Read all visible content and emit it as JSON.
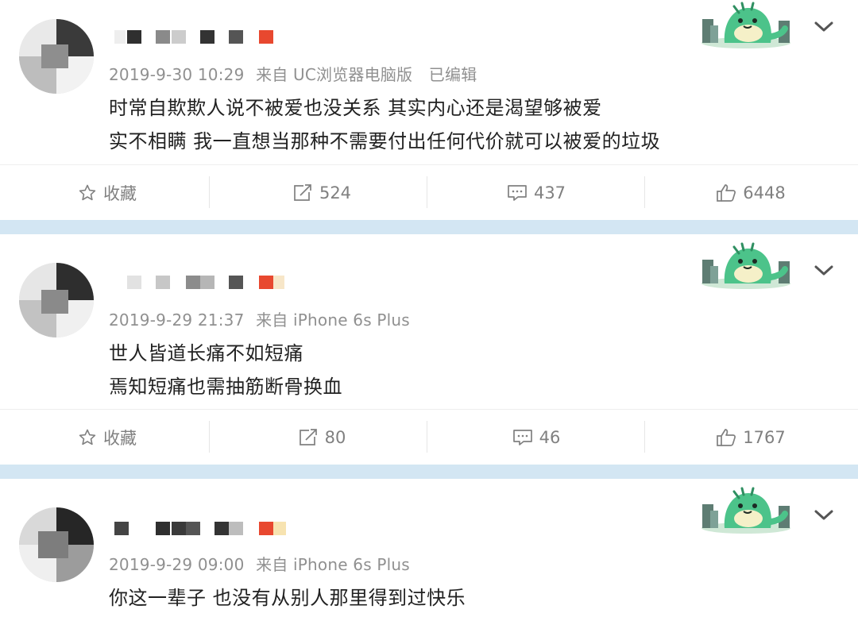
{
  "colors": {
    "separator": "#d3e6f3",
    "timestamp": "#909090",
    "text": "#222222",
    "action": "#808080",
    "badge_accent": "#e8482f"
  },
  "posts": [
    {
      "timestamp": "2019-9-30 10:29",
      "source": "来自 UC浏览器电脑版",
      "edited": "已编辑",
      "lines": [
        "时常自欺欺人说不被爱也没关系 其实内心还是渴望够被爱",
        "实不相瞒 我一直想当那种不需要付出任何代价就可以被爱的垃圾"
      ],
      "actions": {
        "favorite": "收藏",
        "repost": "524",
        "comment": "437",
        "like": "6448"
      }
    },
    {
      "timestamp": "2019-9-29 21:37",
      "source": "来自 iPhone 6s Plus",
      "edited": "",
      "lines": [
        "世人皆道长痛不如短痛",
        "焉知短痛也需抽筋断骨换血"
      ],
      "actions": {
        "favorite": "收藏",
        "repost": "80",
        "comment": "46",
        "like": "1767"
      }
    },
    {
      "timestamp": "2019-9-29 09:00",
      "source": "来自 iPhone 6s Plus",
      "edited": "",
      "lines": [
        "你这一辈子 也没有从别人那里得到过快乐"
      ]
    }
  ],
  "icons": {
    "avatar": "pixelated-avatar",
    "badge": "green-dinosaur-badge",
    "chevron": "chevron-down-icon",
    "favorite": "star-icon",
    "repost": "repost-icon",
    "comment": "comment-icon",
    "like": "thumbs-up-icon"
  }
}
